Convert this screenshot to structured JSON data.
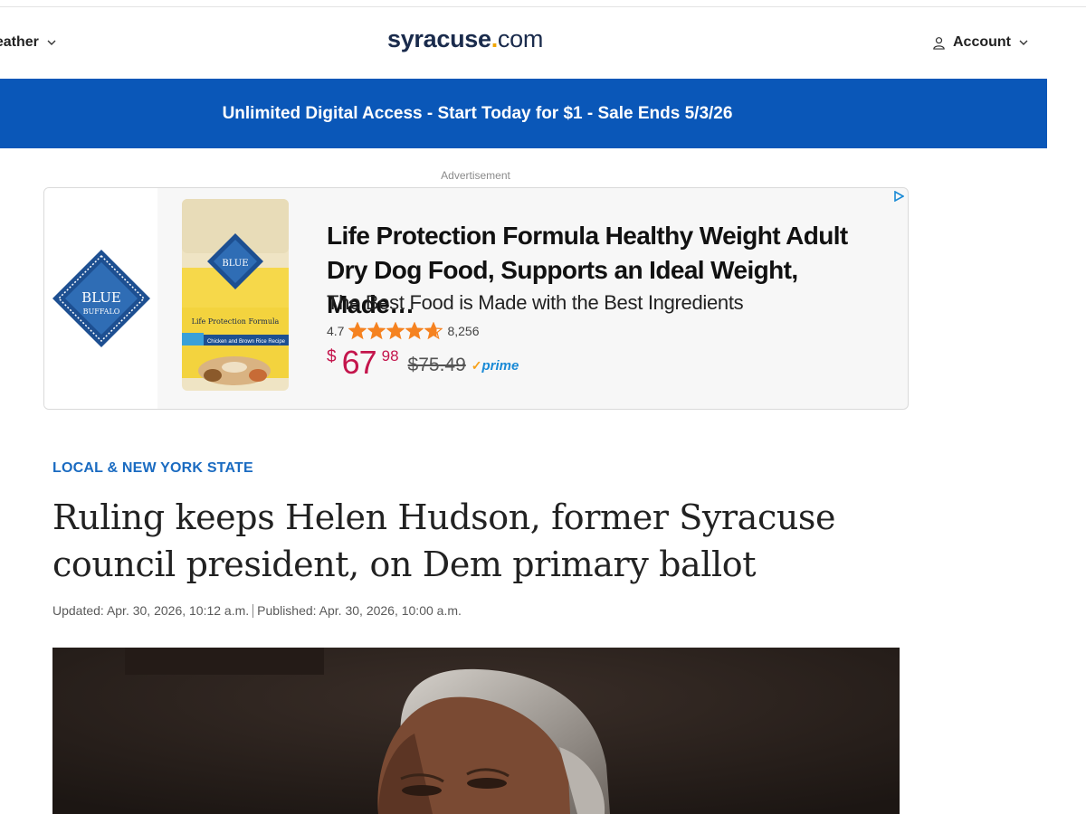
{
  "header": {
    "weather_label": "Weather",
    "logo": {
      "part1": "syracuse",
      "part2": ".",
      "part3": "com"
    },
    "account_label": "Account"
  },
  "promo": {
    "text": "Unlimited Digital Access - Start Today for $1 - Sale Ends 5/3/26"
  },
  "ad": {
    "label": "Advertisement",
    "brand_name_line1": "BLUE",
    "brand_name_line2": "BUFFALO",
    "bag_text": "Life Protection Formula",
    "bag_flavor": "Chicken and Brown Rice Recipe",
    "title": "Life Protection Formula Healthy Weight Adult Dry Dog Food, Supports an Ideal Weight, Made…",
    "subtitle": "The Best Food is Made with the Best Ingredients",
    "rating": "4.7",
    "review_count": "8,256",
    "stars": 4.7,
    "price": {
      "currency": "$",
      "whole": "67",
      "fraction": "98",
      "old": "$75.49"
    },
    "prime_label": "prime",
    "colors": {
      "price": "#c4154c",
      "star": "#f58220",
      "prime": "#1a8ad6"
    }
  },
  "article": {
    "section": "LOCAL & NEW YORK STATE",
    "headline": "Ruling keeps Helen Hudson, former Syracuse council president, on Dem primary ballot",
    "updated": "Updated: Apr. 30, 2026, 10:12 a.m.",
    "published": "Published: Apr. 30, 2026, 10:00 a.m."
  },
  "colors": {
    "brand_navy": "#1a2b4c",
    "brand_gold": "#f0a500",
    "promo_blue": "#0a57b8",
    "kicker_blue": "#1a6bc1"
  }
}
